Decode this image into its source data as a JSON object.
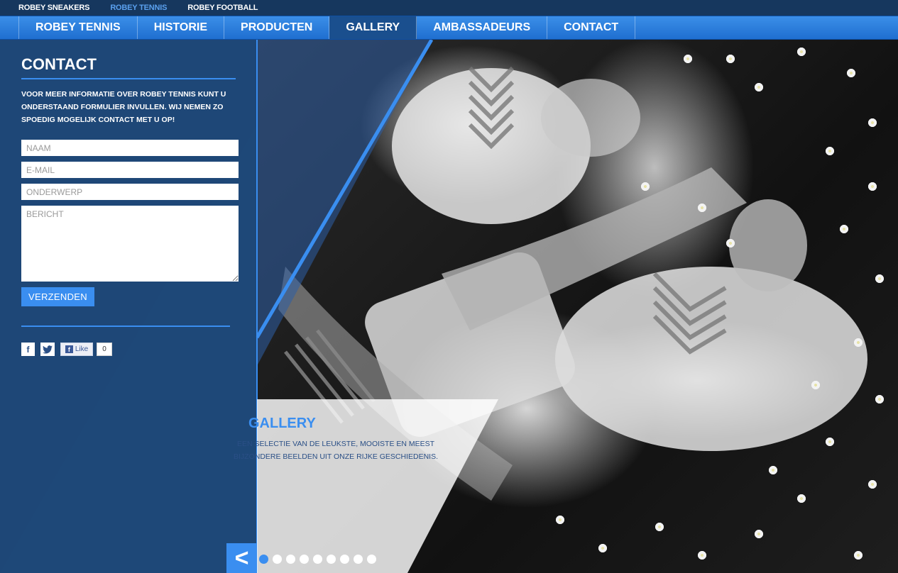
{
  "brand_bar": {
    "links": [
      {
        "label": "ROBEY SNEAKERS",
        "active": false
      },
      {
        "label": "ROBEY TENNIS",
        "active": true
      },
      {
        "label": "ROBEY FOOTBALL",
        "active": false
      }
    ]
  },
  "nav": {
    "items": [
      {
        "label": "ROBEY TENNIS",
        "active": false
      },
      {
        "label": "HISTORIE",
        "active": false
      },
      {
        "label": "PRODUCTEN",
        "active": false
      },
      {
        "label": "GALLERY",
        "active": true
      },
      {
        "label": "AMBASSADEURS",
        "active": false
      },
      {
        "label": "CONTACT",
        "active": false
      }
    ]
  },
  "contact": {
    "title": "CONTACT",
    "intro": "VOOR MEER INFORMATIE OVER ROBEY TENNIS KUNT U ONDERSTAAND FORMULIER INVULLEN. WIJ NEMEN ZO SPOEDIG MOGELIJK CONTACT MET U OP!",
    "fields": {
      "name_placeholder": "NAAM",
      "email_placeholder": "E-MAIL",
      "subject_placeholder": "ONDERWERP",
      "message_placeholder": "BERICHT"
    },
    "submit_label": "VERZENDEN"
  },
  "social": {
    "facebook_icon": "f",
    "twitter_icon": "twitter-bird",
    "like_label": "Like",
    "like_count": "0"
  },
  "gallery": {
    "title": "GALLERY",
    "description": "EEN SELECTIE VAN DE LEUKSTE, MOOISTE EN MEEST BIJZONDERE BEELDEN UIT ONZE RIJKE GESCHIEDENIS."
  },
  "slider": {
    "prev_icon": "<",
    "dot_count": 9,
    "active_index": 0
  },
  "colors": {
    "accent": "#3a8ef0",
    "panel": "#1e4878",
    "topbar": "#16375e"
  }
}
